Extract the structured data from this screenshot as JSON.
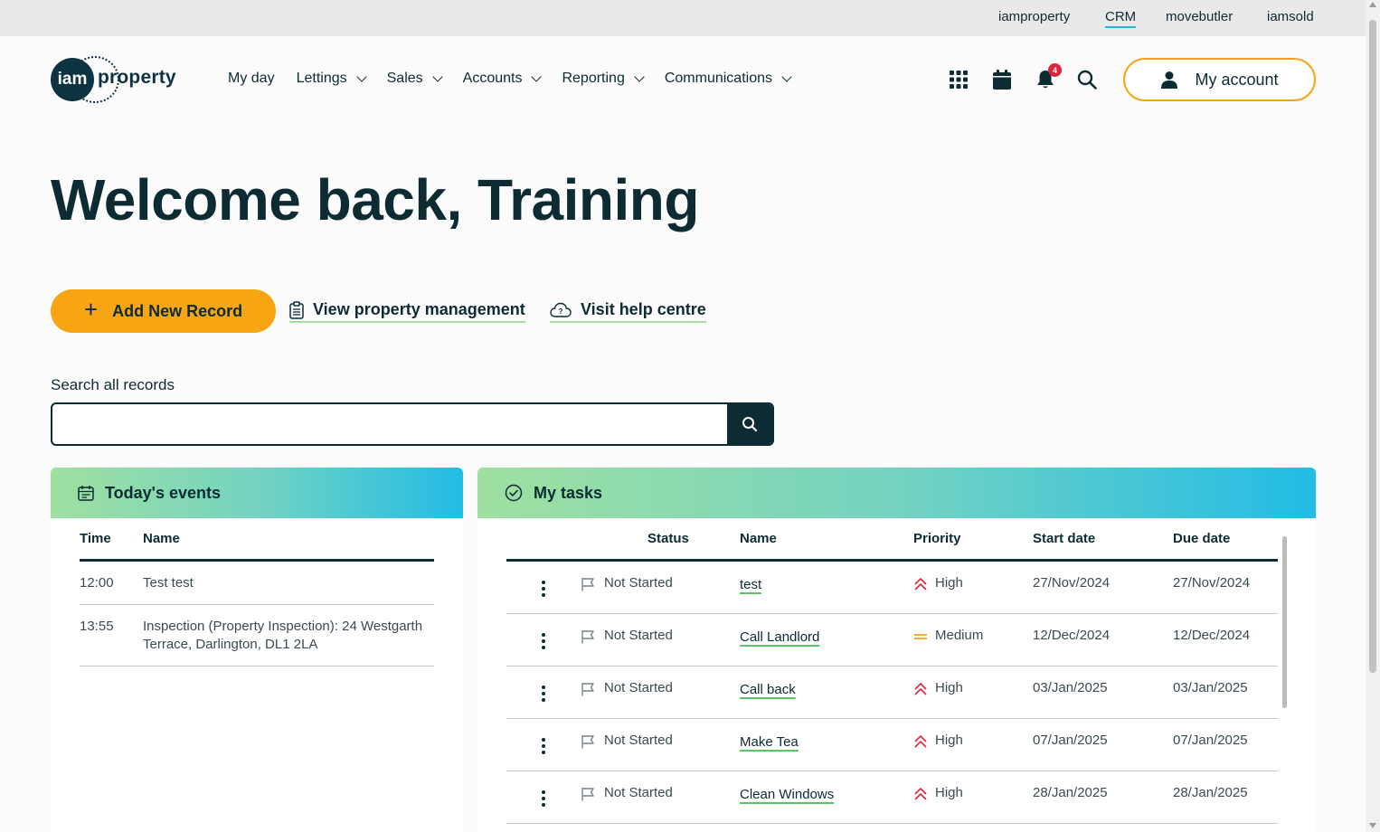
{
  "util_bar": {
    "links": [
      "iamproperty",
      "CRM",
      "movebutler",
      "iamsold"
    ],
    "active": "CRM"
  },
  "logo": {
    "mark": "iam",
    "word": "property"
  },
  "nav": {
    "my_day": "My day",
    "lettings": "Lettings",
    "sales": "Sales",
    "accounts": "Accounts",
    "reporting": "Reporting",
    "communications": "Communications"
  },
  "header_icons": {
    "apps": "apps-grid-icon",
    "calendar": "calendar-icon",
    "notifications": "bell-icon",
    "notification_count": "4",
    "search": "search-icon"
  },
  "account": {
    "label": "My account"
  },
  "welcome": {
    "title": "Welcome back, Training"
  },
  "actions": {
    "add_record": "Add New Record",
    "view_property": "View property management",
    "help_centre": "Visit help centre"
  },
  "search": {
    "label": "Search all records",
    "value": "",
    "placeholder": ""
  },
  "events": {
    "title": "Today's events",
    "columns": [
      "Time",
      "Name"
    ],
    "rows": [
      {
        "time": "12:00",
        "name": "Test test"
      },
      {
        "time": "13:55",
        "name": "Inspection (Property Inspection): 24 Westgarth Terrace, Darlington, DL1 2LA"
      }
    ]
  },
  "tasks": {
    "title": "My tasks",
    "columns": [
      "Status",
      "Name",
      "Priority",
      "Start date",
      "Due date"
    ],
    "rows": [
      {
        "status": "Not Started",
        "name": "test",
        "priority": "High",
        "start": "27/Nov/2024",
        "due": "27/Nov/2024"
      },
      {
        "status": "Not Started",
        "name": "Call Landlord",
        "priority": "Medium",
        "start": "12/Dec/2024",
        "due": "12/Dec/2024"
      },
      {
        "status": "Not Started",
        "name": "Call back",
        "priority": "High",
        "start": "03/Jan/2025",
        "due": "03/Jan/2025"
      },
      {
        "status": "Not Started",
        "name": "Make Tea",
        "priority": "High",
        "start": "07/Jan/2025",
        "due": "07/Jan/2025"
      },
      {
        "status": "Not Started",
        "name": "Clean Windows",
        "priority": "High",
        "start": "28/Jan/2025",
        "due": "28/Jan/2025"
      }
    ]
  },
  "colors": {
    "brand_dark": "#0d2b33",
    "accent_orange": "#f7a512",
    "high_priority": "#d7263d",
    "medium_priority": "#f7a512",
    "link_underline": "#5bc46a"
  }
}
